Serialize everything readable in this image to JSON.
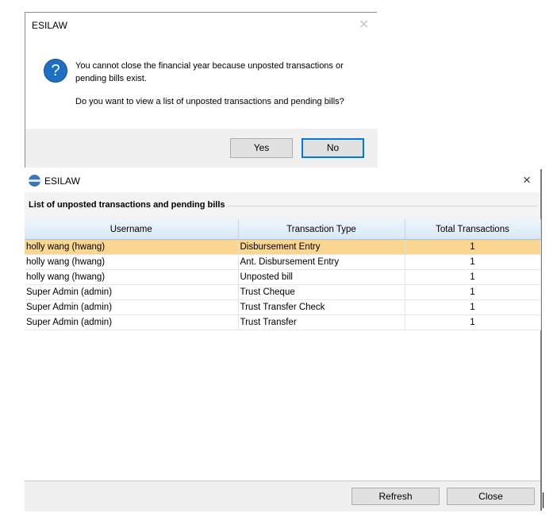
{
  "dialog": {
    "title": "ESILAW",
    "message_line1": "You cannot close the financial year because unposted transactions or pending bills exist.",
    "message_line2": "Do you want to view a list of unposted transactions and pending bills?",
    "icon": "question-icon",
    "yes_label": "Yes",
    "no_label": "No"
  },
  "window": {
    "title": "ESILAW",
    "close_glyph": "×",
    "section_title": "List of unposted transactions and pending bills",
    "columns": [
      "Username",
      "Transaction Type",
      "Total Transactions"
    ],
    "rows": [
      {
        "username": "holly wang (hwang)",
        "type": "Disbursement Entry",
        "total": "1"
      },
      {
        "username": "holly wang (hwang)",
        "type": "Ant. Disbursement Entry",
        "total": "1"
      },
      {
        "username": "holly wang (hwang)",
        "type": "Unposted bill",
        "total": "1"
      },
      {
        "username": "Super Admin (admin)",
        "type": "Trust Cheque",
        "total": "1"
      },
      {
        "username": "Super Admin (admin)",
        "type": "Trust Transfer Check",
        "total": "1"
      },
      {
        "username": "Super Admin (admin)",
        "type": "Trust Transfer",
        "total": "1"
      }
    ],
    "selected_row_color": "#fbd690",
    "refresh_label": "Refresh",
    "close_label": "Close"
  }
}
